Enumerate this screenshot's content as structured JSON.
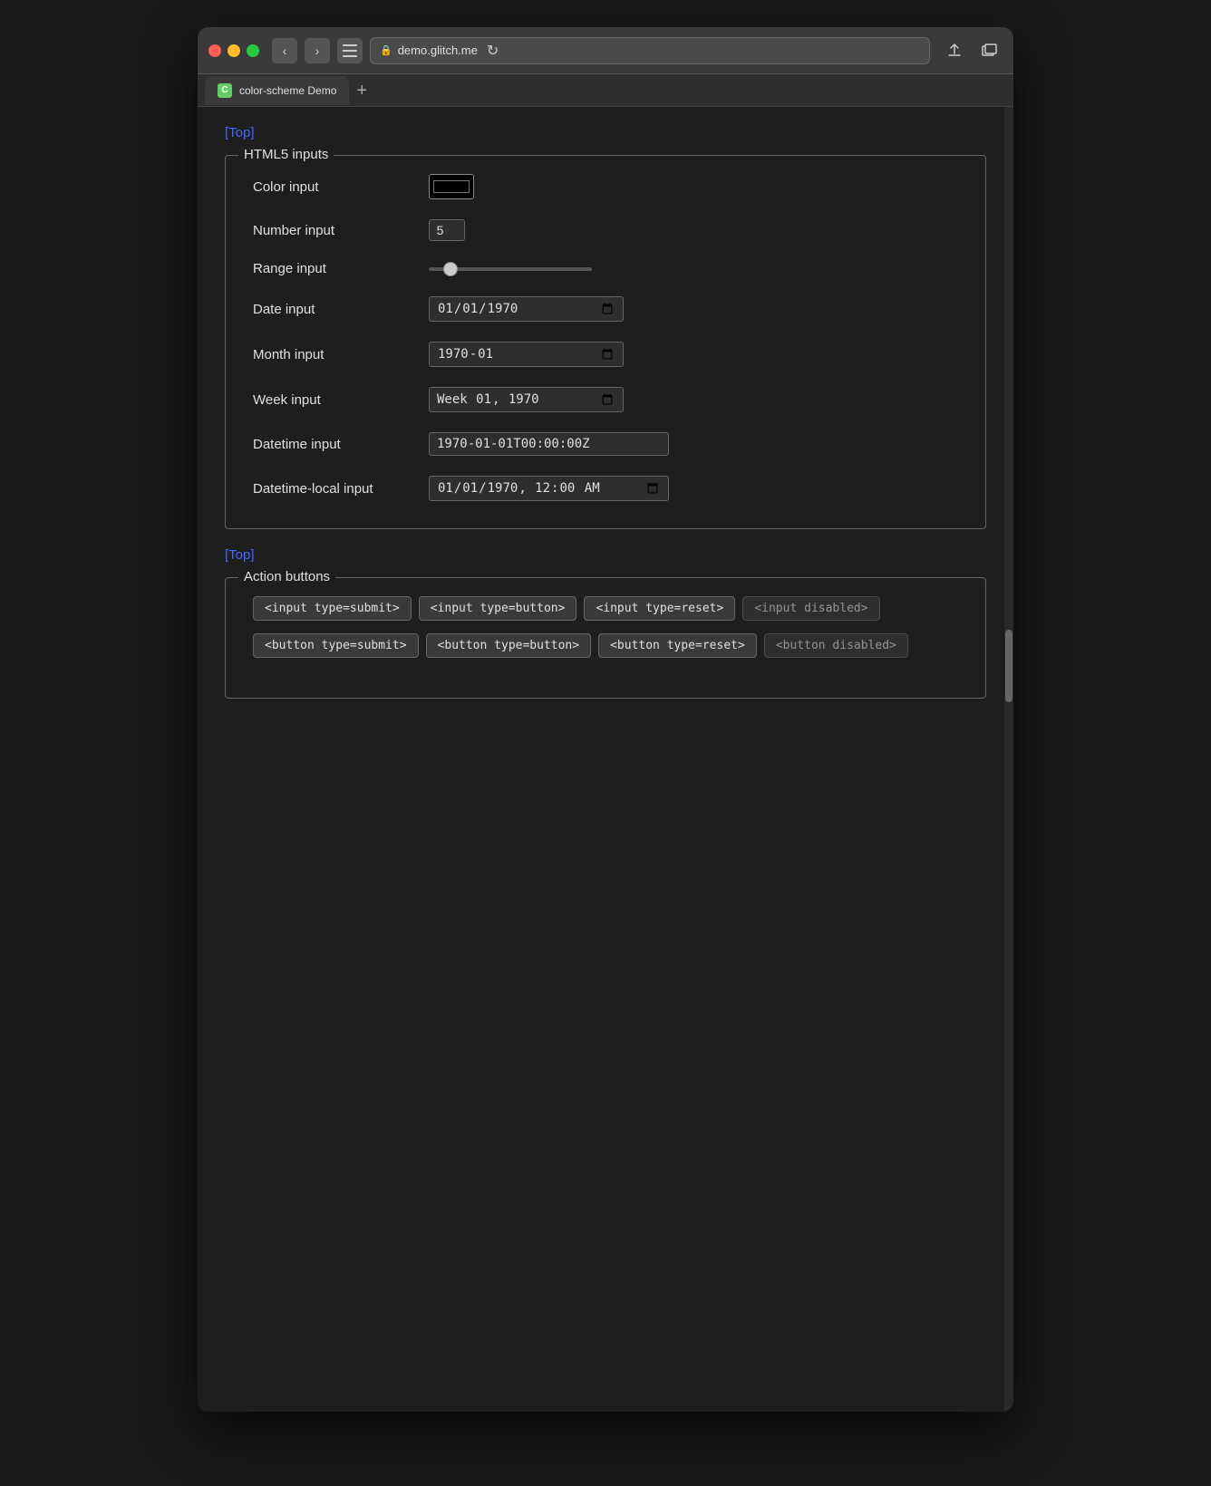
{
  "browser": {
    "traffic_lights": [
      "red",
      "yellow",
      "green"
    ],
    "nav_back": "‹",
    "nav_forward": "›",
    "address": "demo.glitch.me",
    "tab_title": "color-scheme Demo",
    "tab_favicon": "C",
    "new_tab_label": "+"
  },
  "page": {
    "top_link_1": "[Top]",
    "top_link_2": "[Top]",
    "html5_legend": "HTML5 inputs",
    "action_buttons_legend": "Action buttons",
    "fields": {
      "color_label": "Color input",
      "color_value": "#000000",
      "number_label": "Number input",
      "number_value": "5",
      "range_label": "Range input",
      "range_value": "10",
      "date_label": "Date input",
      "date_value": "1970-01-01",
      "month_label": "Month input",
      "month_value": "1970-01",
      "week_label": "Week input",
      "week_value": "1970-W01",
      "datetime_label": "Datetime input",
      "datetime_value": "1970-01-01T00:00:00Z",
      "datetime_local_label": "Datetime-local input",
      "datetime_local_value": "1970-01-01T00:00"
    },
    "action_buttons": {
      "input_submit": "<input type=submit>",
      "input_button": "<input type=button>",
      "input_reset": "<input type=reset>",
      "input_disabled": "<input disabled>",
      "button_submit": "<button type=submit>",
      "button_button": "<button type=button>",
      "button_reset": "<button type=reset>",
      "button_disabled": "<button disabled>"
    }
  }
}
